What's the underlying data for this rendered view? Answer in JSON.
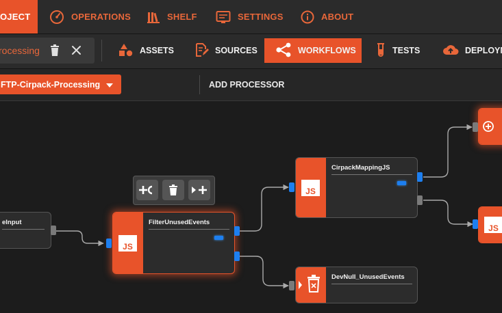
{
  "nav": {
    "project": "OJECT",
    "operations": "OPERATIONS",
    "shelf": "SHELF",
    "settings": "SETTINGS",
    "about": "ABOUT"
  },
  "search": {
    "value": "rocessing"
  },
  "tabs": {
    "assets": "ASSETS",
    "sources": "SOURCES",
    "workflows": "WORKFLOWS",
    "tests": "TESTS",
    "deployments": "DEPLOYM"
  },
  "toolbar3": {
    "workflow_selected": "FTP-Cirpack-Processing",
    "add_processor": "ADD PROCESSOR"
  },
  "nodes": {
    "input": "eInput",
    "filter": "FilterUnusedEvents",
    "cirpack": "CirpackMappingJS",
    "devnull": "DevNull_UnusedEvents"
  },
  "badges": {
    "js": "JS"
  },
  "colors": {
    "accent": "#e8532a",
    "led": "#1d7ff0",
    "background": "#1c1c1c"
  },
  "icons": {
    "operations": "gauge-icon",
    "shelf": "books-icon",
    "settings": "settings-panel-icon",
    "about": "info-icon",
    "assets": "shapes-icon",
    "sources": "edit-document-icon",
    "workflows": "share-nodes-icon",
    "tests": "test-tube-icon",
    "deployments": "cloud-upload-icon"
  }
}
